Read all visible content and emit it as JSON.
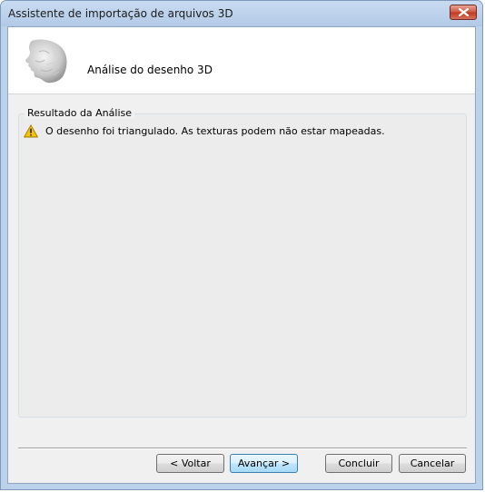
{
  "window": {
    "title": "Assistente de importação de arquivos 3D"
  },
  "header": {
    "heading": "Análise do desenho 3D",
    "logo_icon": "3d-head-model-icon"
  },
  "analysis_group": {
    "legend": "Resultado da Análise",
    "message_icon": "warning-icon",
    "message": "O desenho foi triangulado. As texturas podem não estar mapeadas."
  },
  "buttons": {
    "back": "< Voltar",
    "next": "Avançar >",
    "finish": "Concluir",
    "cancel": "Cancelar"
  },
  "colors": {
    "titlebar": "#c9dbf1",
    "close_button": "#c0381e",
    "default_button_border": "#3c7fb1",
    "warning": "#f4c400"
  }
}
